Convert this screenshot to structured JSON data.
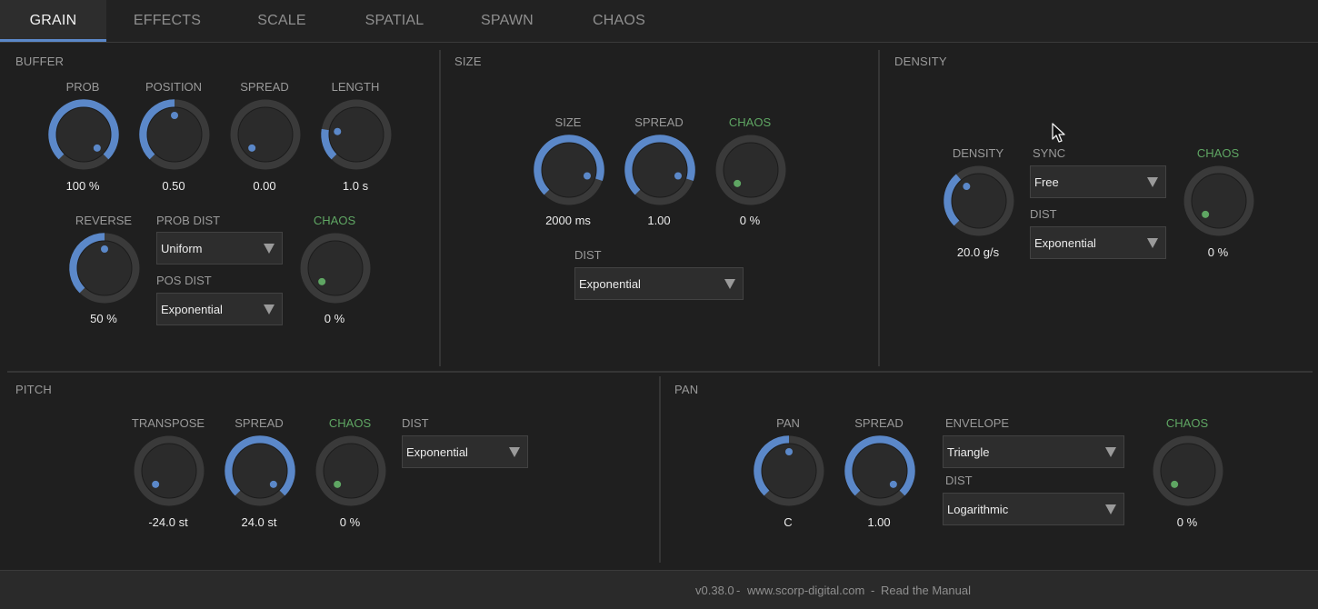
{
  "colors": {
    "accent": "#5b88c9",
    "track": "#3a3a3a",
    "knob_body": "#2b2b2b",
    "chaos_green": "#5fa663"
  },
  "tabs": [
    "GRAIN",
    "EFFECTS",
    "SCALE",
    "SPATIAL",
    "SPAWN",
    "CHAOS"
  ],
  "active_tab": "GRAIN",
  "buffer": {
    "title": "BUFFER",
    "prob": {
      "label": "PROB",
      "value": "100 %",
      "level": 1.0
    },
    "position": {
      "label": "POSITION",
      "value": "0.50",
      "level": 0.5
    },
    "spread": {
      "label": "SPREAD",
      "value": "0.00",
      "level": 0.0
    },
    "length": {
      "label": "LENGTH",
      "value": "1.0 s",
      "level": 0.2
    },
    "reverse": {
      "label": "REVERSE",
      "value": "50 %",
      "level": 0.5
    },
    "chaos": {
      "label": "CHAOS",
      "value": "0 %",
      "level": 0.0
    },
    "prob_dist": {
      "label": "PROB DIST",
      "value": "Uniform"
    },
    "pos_dist": {
      "label": "POS DIST",
      "value": "Exponential"
    }
  },
  "size": {
    "title": "SIZE",
    "size": {
      "label": "SIZE",
      "value": "2000 ms",
      "level": 0.9
    },
    "spread": {
      "label": "SPREAD",
      "value": "1.00",
      "level": 0.9
    },
    "chaos": {
      "label": "CHAOS",
      "value": "0 %",
      "level": 0.0
    },
    "dist": {
      "label": "DIST",
      "value": "Exponential"
    }
  },
  "density": {
    "title": "DENSITY",
    "density": {
      "label": "DENSITY",
      "value": "20.0 g/s",
      "level": 0.35
    },
    "sync": {
      "label": "SYNC",
      "value": "Free"
    },
    "dist": {
      "label": "DIST",
      "value": "Exponential"
    },
    "chaos": {
      "label": "CHAOS",
      "value": "0 %",
      "level": 0.0
    }
  },
  "pitch": {
    "title": "PITCH",
    "transpose": {
      "label": "TRANSPOSE",
      "value": "-24.0 st",
      "level": 0.0
    },
    "spread": {
      "label": "SPREAD",
      "value": "24.0 st",
      "level": 1.0
    },
    "chaos": {
      "label": "CHAOS",
      "value": "0 %",
      "level": 0.0
    },
    "dist": {
      "label": "DIST",
      "value": "Exponential"
    }
  },
  "pan": {
    "title": "PAN",
    "pan": {
      "label": "PAN",
      "value": "C",
      "level": 0.5
    },
    "spread": {
      "label": "SPREAD",
      "value": "1.00",
      "level": 1.0
    },
    "envelope": {
      "label": "ENVELOPE",
      "value": "Triangle"
    },
    "dist": {
      "label": "DIST",
      "value": "Logarithmic"
    },
    "chaos": {
      "label": "CHAOS",
      "value": "0 %",
      "level": 0.0
    }
  },
  "footer": {
    "version": "v0.38.0",
    "sep1": "-",
    "website": "www.scorp-digital.com",
    "sep2": "-",
    "manual": "Read the Manual"
  }
}
